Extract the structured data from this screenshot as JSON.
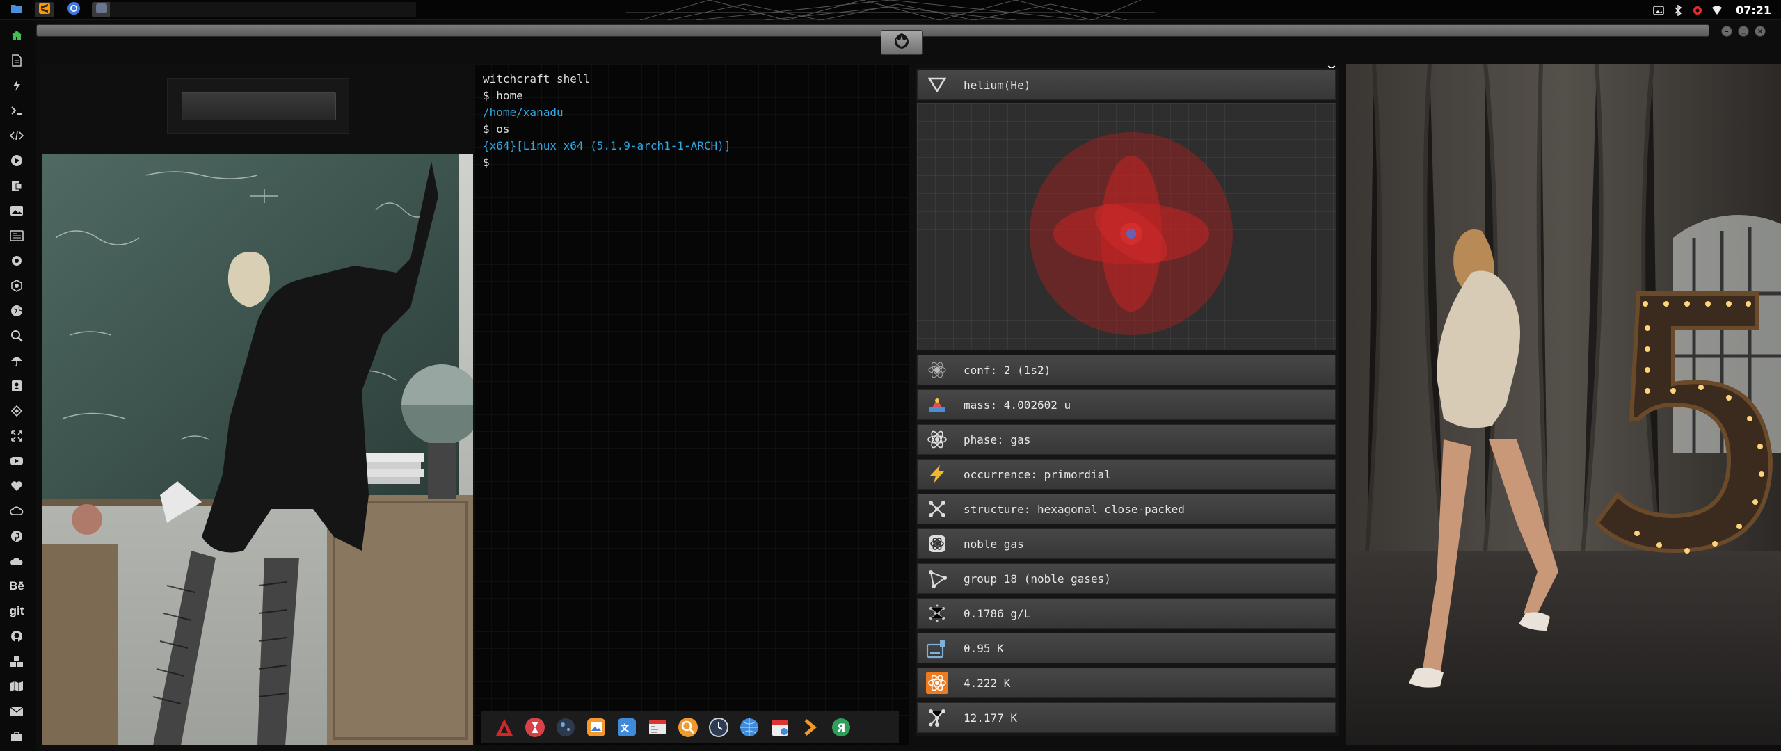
{
  "system": {
    "clock": "07:21"
  },
  "leftdock": {
    "items": [
      "home-icon",
      "document-icon",
      "bolt-icon",
      "terminal-icon",
      "code-icon",
      "play-icon",
      "presentation-icon",
      "image-icon",
      "news-icon",
      "settings-icon",
      "hexagon-icon",
      "globe-icon",
      "search-icon",
      "umbrella-icon",
      "contacts-icon",
      "tag-icon",
      "fullscreen-icon",
      "youtube-icon",
      "heart-icon",
      "cloud-link-icon",
      "pinterest-icon",
      "cloud-icon",
      "behance-icon",
      "git-icon",
      "github-icon",
      "cubes-icon",
      "map-icon",
      "mail-icon",
      "toolbox-icon"
    ],
    "behance_label": "Bē",
    "git_label": "git"
  },
  "terminal": {
    "lines": [
      {
        "text": "witchcraft shell",
        "style": "white"
      },
      {
        "text": "$ home",
        "style": "white"
      },
      {
        "text": "/home/xanadu",
        "style": "blue"
      },
      {
        "text": "$ os",
        "style": "white"
      },
      {
        "text": "{x64}[Linux x64 (5.1.9-arch1-1-ARCH)]",
        "style": "blue"
      },
      {
        "text": "$",
        "style": "white"
      }
    ]
  },
  "element": {
    "close_label": "×",
    "header": "helium(He)",
    "rows": [
      {
        "icon": "atom-config-icon",
        "text": "conf: 2 (1s2)"
      },
      {
        "icon": "scale-icon",
        "text": "mass: 4.002602 u"
      },
      {
        "icon": "atom-icon",
        "text": "phase: gas"
      },
      {
        "icon": "lightning-icon",
        "text": "occurrence: primordial"
      },
      {
        "icon": "structure-icon",
        "text": "structure: hexagonal close-packed"
      },
      {
        "icon": "noble-gas-icon",
        "text": "noble gas"
      },
      {
        "icon": "group-icon",
        "text": "group 18 (noble gases)"
      },
      {
        "icon": "density-icon",
        "text": "0.1786 g/L"
      },
      {
        "icon": "melting-icon",
        "text": "0.95 K"
      },
      {
        "icon": "boiling-icon",
        "text": "4.222 K"
      },
      {
        "icon": "critical-icon",
        "text": "12.177 K"
      }
    ]
  },
  "colors": {
    "accent_blue": "#2fa8e6",
    "orbital_red": "#b01e1e"
  }
}
